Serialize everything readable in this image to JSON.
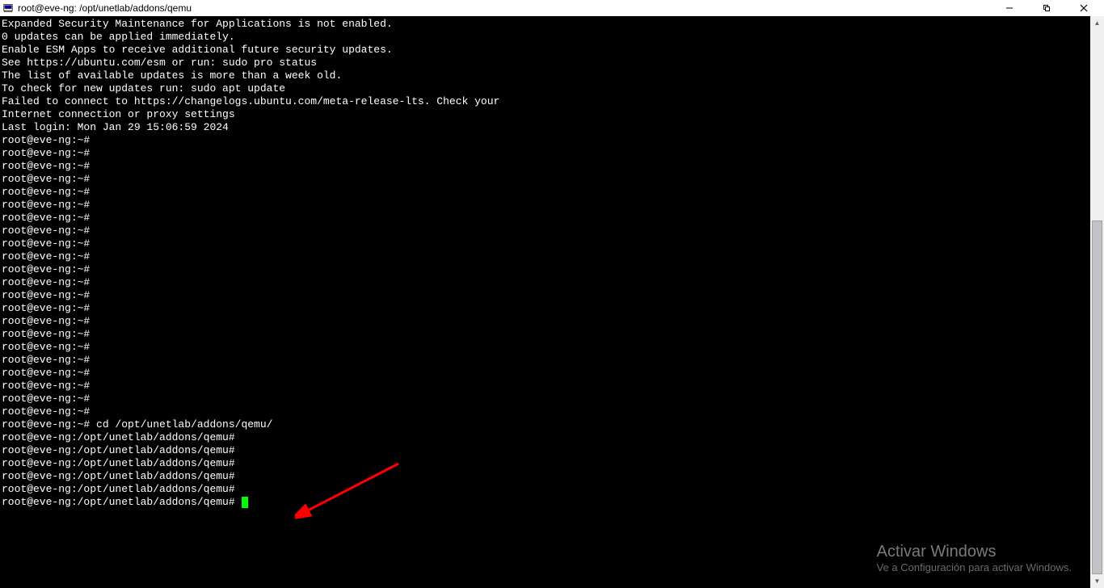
{
  "window": {
    "title": "root@eve-ng: /opt/unetlab/addons/qemu"
  },
  "terminal": {
    "lines": [
      "Expanded Security Maintenance for Applications is not enabled.",
      "",
      "0 updates can be applied immediately.",
      "",
      "Enable ESM Apps to receive additional future security updates.",
      "See https://ubuntu.com/esm or run: sudo pro status",
      "",
      "",
      "The list of available updates is more than a week old.",
      "To check for new updates run: sudo apt update",
      "Failed to connect to https://changelogs.ubuntu.com/meta-release-lts. Check your",
      "Internet connection or proxy settings",
      "",
      "",
      "Last login: Mon Jan 29 15:06:59 2024",
      "root@eve-ng:~#",
      "root@eve-ng:~#",
      "root@eve-ng:~#",
      "root@eve-ng:~#",
      "root@eve-ng:~#",
      "root@eve-ng:~#",
      "root@eve-ng:~#",
      "root@eve-ng:~#",
      "root@eve-ng:~#",
      "root@eve-ng:~#",
      "root@eve-ng:~#",
      "root@eve-ng:~#",
      "root@eve-ng:~#",
      "root@eve-ng:~#",
      "root@eve-ng:~#",
      "root@eve-ng:~#",
      "root@eve-ng:~#",
      "root@eve-ng:~#",
      "root@eve-ng:~#",
      "root@eve-ng:~#",
      "root@eve-ng:~#",
      "root@eve-ng:~#",
      "root@eve-ng:~# cd /opt/unetlab/addons/qemu/",
      "root@eve-ng:/opt/unetlab/addons/qemu#",
      "root@eve-ng:/opt/unetlab/addons/qemu#",
      "root@eve-ng:/opt/unetlab/addons/qemu#",
      "root@eve-ng:/opt/unetlab/addons/qemu#",
      "root@eve-ng:/opt/unetlab/addons/qemu#",
      "root@eve-ng:/opt/unetlab/addons/qemu# "
    ]
  },
  "watermark": {
    "title": "Activar Windows",
    "subtitle": "Ve a Configuración para activar Windows."
  },
  "scrollbar": {
    "thumb_top_pct": 35,
    "thumb_height_pct": 65
  }
}
